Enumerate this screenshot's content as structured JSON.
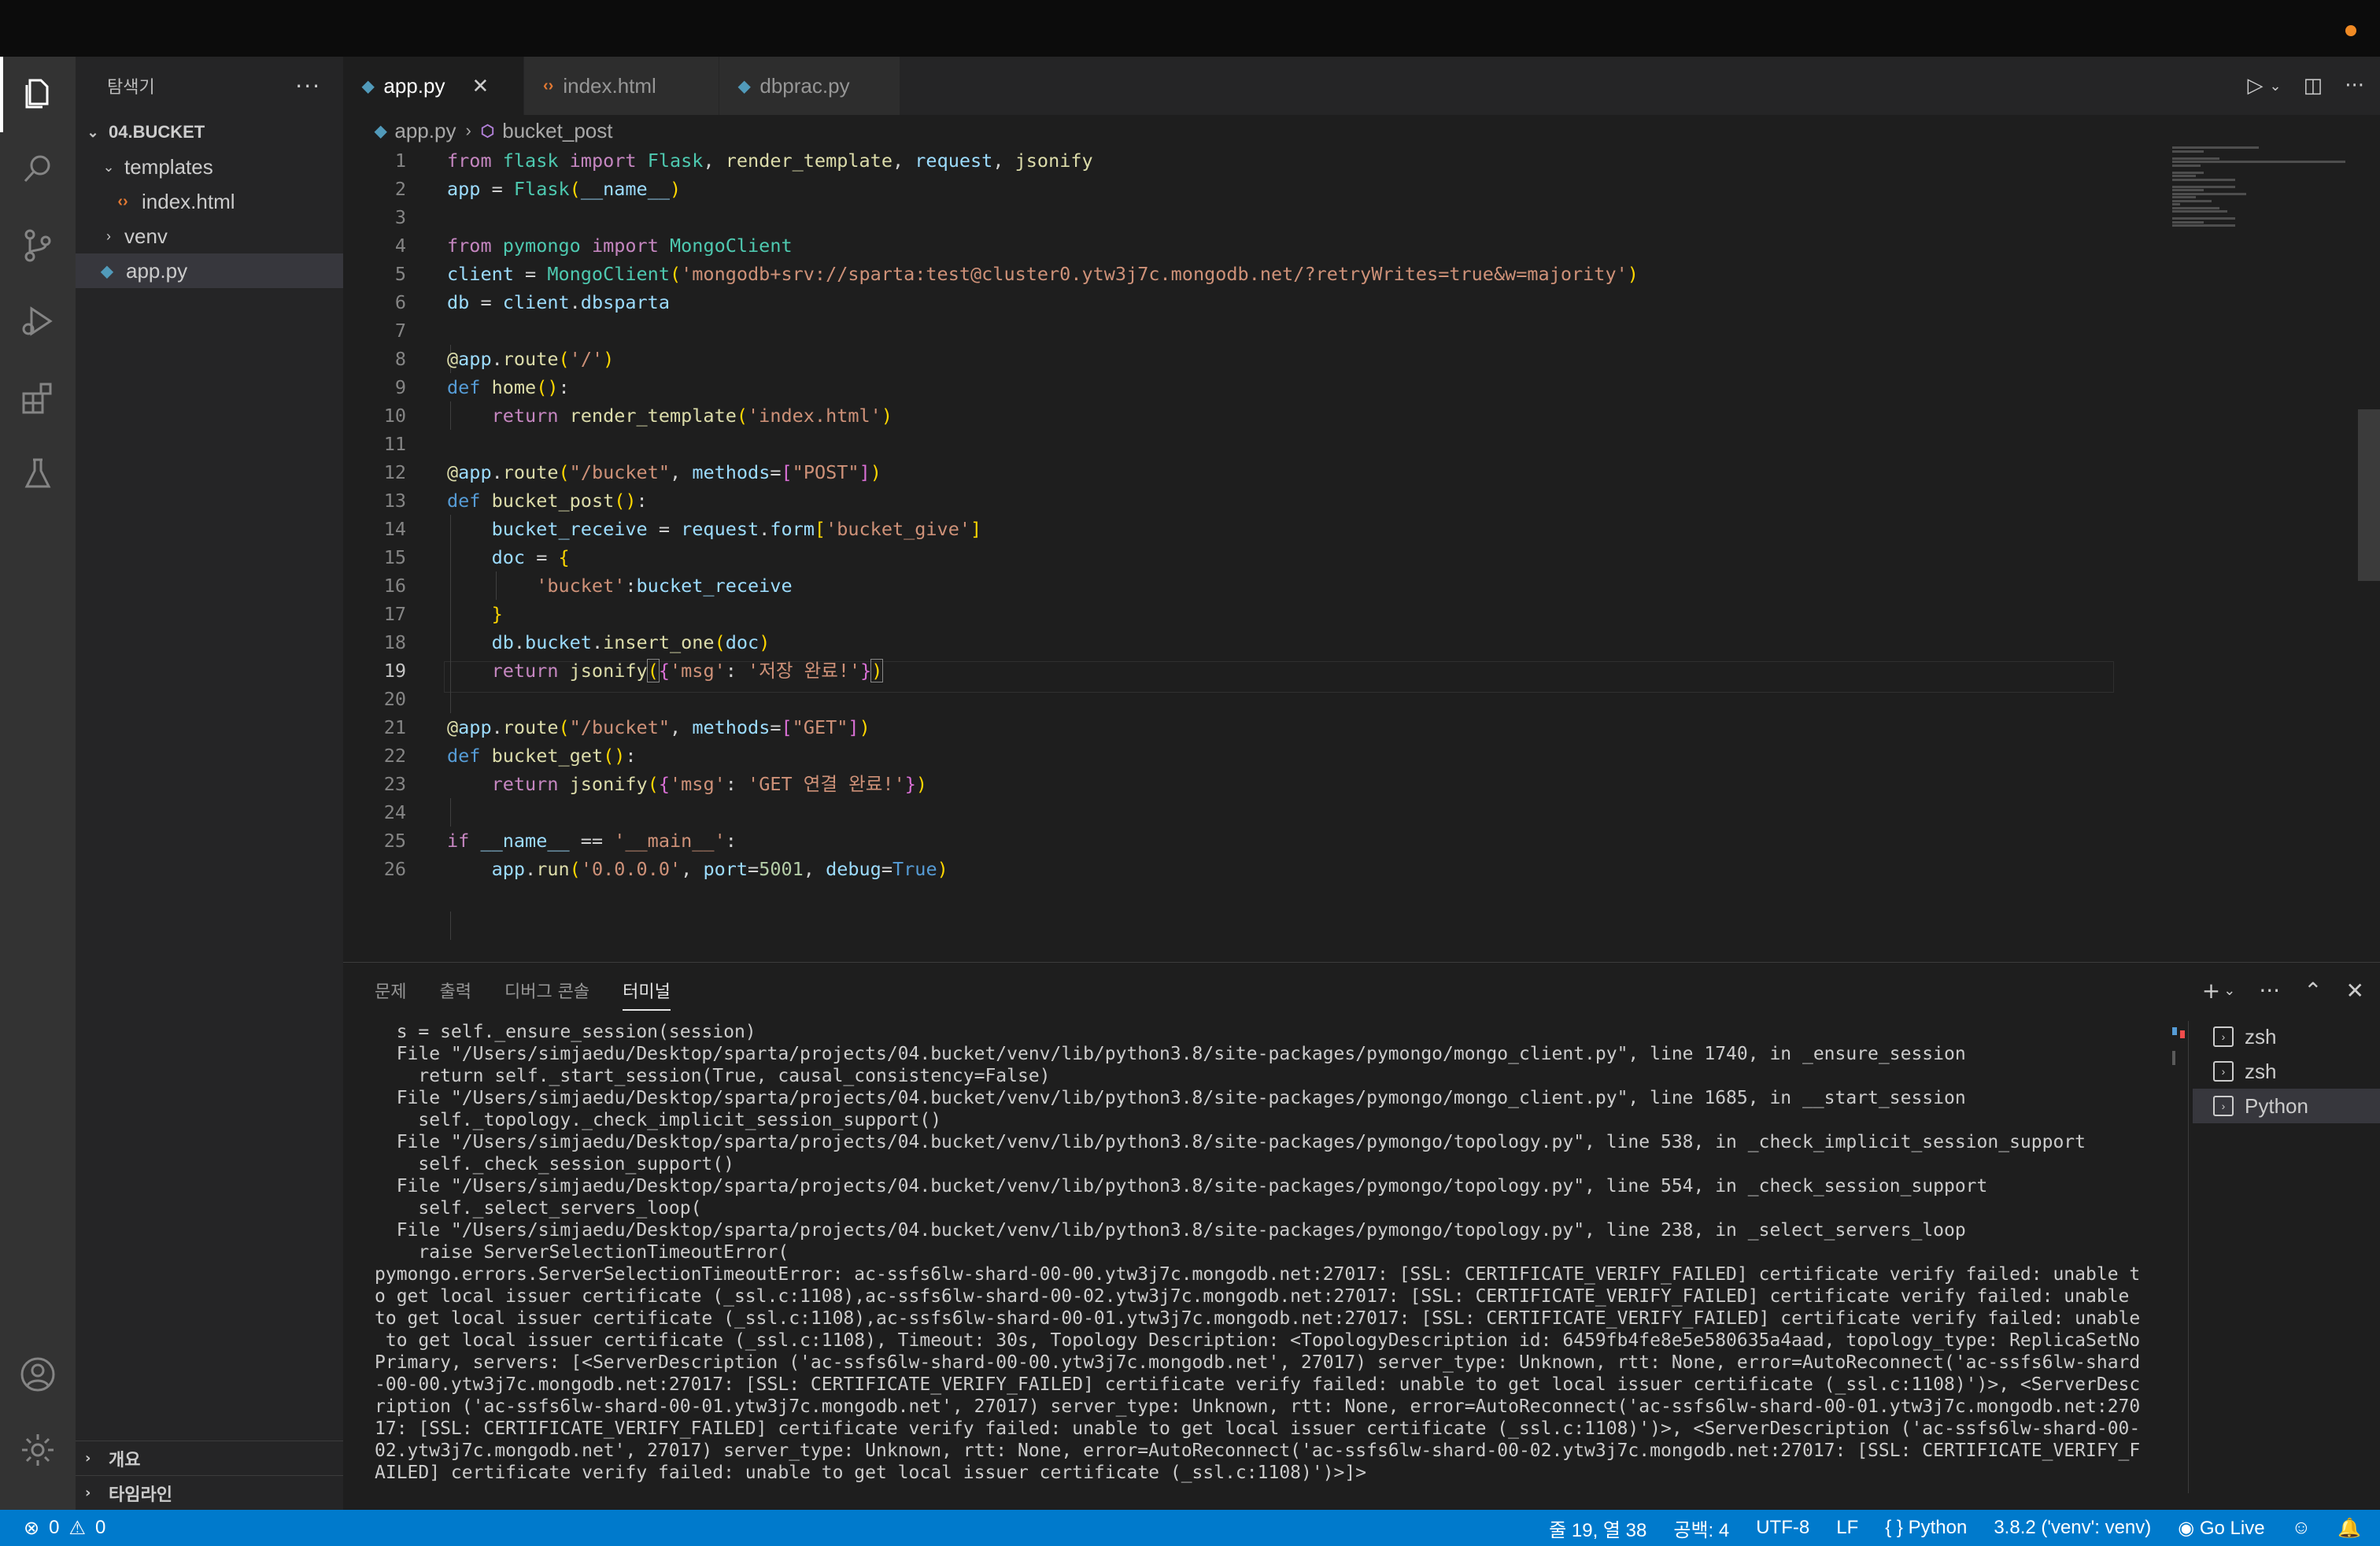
{
  "explorer": {
    "title": "탐색기",
    "more": "···",
    "root": "04.BUCKET",
    "items": [
      {
        "label": "templates",
        "type": "folder-open"
      },
      {
        "label": "index.html",
        "type": "html"
      },
      {
        "label": "venv",
        "type": "folder"
      },
      {
        "label": "app.py",
        "type": "python",
        "selected": true
      }
    ],
    "outline": "개요",
    "timeline": "타임라인"
  },
  "tabs": [
    {
      "label": "app.py",
      "icon": "python-icon",
      "active": true,
      "close": "✕"
    },
    {
      "label": "index.html",
      "icon": "html-icon",
      "active": false
    },
    {
      "label": "dbprac.py",
      "icon": "python-icon",
      "active": false
    }
  ],
  "breadcrumb": {
    "file": "app.py",
    "symbol": "bucket_post"
  },
  "code": {
    "current_line": 19,
    "lines": [
      "1",
      "2",
      "3",
      "4",
      "5",
      "6",
      "7",
      "8",
      "9",
      "10",
      "11",
      "12",
      "13",
      "14",
      "15",
      "16",
      "17",
      "18",
      "19",
      "20",
      "21",
      "22",
      "23",
      "24",
      "25",
      "26"
    ]
  },
  "panel": {
    "tabs": [
      "문제",
      "출력",
      "디버그 콘솔",
      "터미널"
    ],
    "active_tab": "터미널",
    "terminal_output": "  s = self._ensure_session(session)\n  File \"/Users/simjaedu/Desktop/sparta/projects/04.bucket/venv/lib/python3.8/site-packages/pymongo/mongo_client.py\", line 1740, in _ensure_session\n    return self._start_session(True, causal_consistency=False)\n  File \"/Users/simjaedu/Desktop/sparta/projects/04.bucket/venv/lib/python3.8/site-packages/pymongo/mongo_client.py\", line 1685, in __start_session\n    self._topology._check_implicit_session_support()\n  File \"/Users/simjaedu/Desktop/sparta/projects/04.bucket/venv/lib/python3.8/site-packages/pymongo/topology.py\", line 538, in _check_implicit_session_support\n    self._check_session_support()\n  File \"/Users/simjaedu/Desktop/sparta/projects/04.bucket/venv/lib/python3.8/site-packages/pymongo/topology.py\", line 554, in _check_session_support\n    self._select_servers_loop(\n  File \"/Users/simjaedu/Desktop/sparta/projects/04.bucket/venv/lib/python3.8/site-packages/pymongo/topology.py\", line 238, in _select_servers_loop\n    raise ServerSelectionTimeoutError(\npymongo.errors.ServerSelectionTimeoutError: ac-ssfs6lw-shard-00-00.ytw3j7c.mongodb.net:27017: [SSL: CERTIFICATE_VERIFY_FAILED] certificate verify failed: unable t\no get local issuer certificate (_ssl.c:1108),ac-ssfs6lw-shard-00-02.ytw3j7c.mongodb.net:27017: [SSL: CERTIFICATE_VERIFY_FAILED] certificate verify failed: unable \nto get local issuer certificate (_ssl.c:1108),ac-ssfs6lw-shard-00-01.ytw3j7c.mongodb.net:27017: [SSL: CERTIFICATE_VERIFY_FAILED] certificate verify failed: unable\n to get local issuer certificate (_ssl.c:1108), Timeout: 30s, Topology Description: <TopologyDescription id: 6459fb4fe8e5e580635a4aad, topology_type: ReplicaSetNo\nPrimary, servers: [<ServerDescription ('ac-ssfs6lw-shard-00-00.ytw3j7c.mongodb.net', 27017) server_type: Unknown, rtt: None, error=AutoReconnect('ac-ssfs6lw-shard\n-00-00.ytw3j7c.mongodb.net:27017: [SSL: CERTIFICATE_VERIFY_FAILED] certificate verify failed: unable to get local issuer certificate (_ssl.c:1108)')>, <ServerDesc\nription ('ac-ssfs6lw-shard-00-01.ytw3j7c.mongodb.net', 27017) server_type: Unknown, rtt: None, error=AutoReconnect('ac-ssfs6lw-shard-00-01.ytw3j7c.mongodb.net:270\n17: [SSL: CERTIFICATE_VERIFY_FAILED] certificate verify failed: unable to get local issuer certificate (_ssl.c:1108)')>, <ServerDescription ('ac-ssfs6lw-shard-00-\n02.ytw3j7c.mongodb.net', 27017) server_type: Unknown, rtt: None, error=AutoReconnect('ac-ssfs6lw-shard-00-02.ytw3j7c.mongodb.net:27017: [SSL: CERTIFICATE_VERIFY_F\nAILED] certificate verify failed: unable to get local issuer certificate (_ssl.c:1108)')>]>",
    "terminals": [
      "zsh",
      "zsh",
      "Python"
    ],
    "selected_terminal": "Python"
  },
  "status": {
    "errors": "0",
    "warnings": "0",
    "position": "줄 19, 열 38",
    "spaces": "공백: 4",
    "encoding": "UTF-8",
    "eol": "LF",
    "language": "Python",
    "interpreter": "3.8.2 ('venv': venv)",
    "golive": "Go Live"
  },
  "colors": {
    "statusbar": "#007acc",
    "editor_bg": "#1e1e1e",
    "sidebar_bg": "#252526",
    "activitybar_bg": "#333333"
  }
}
